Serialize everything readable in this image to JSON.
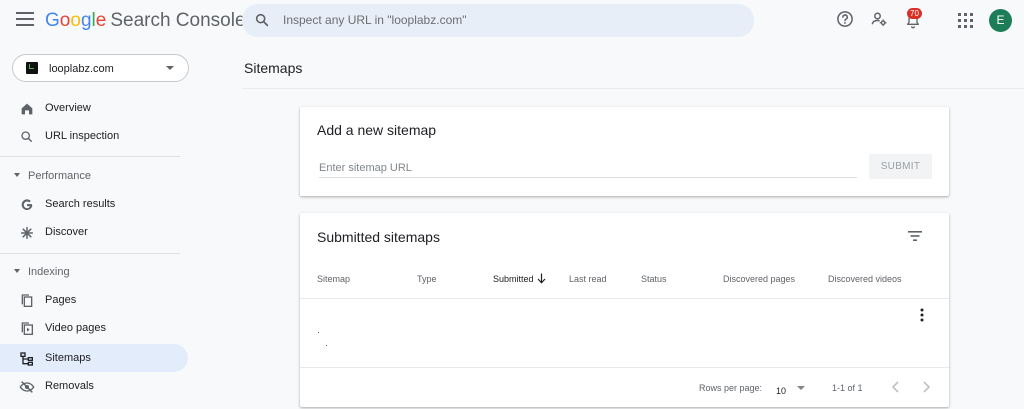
{
  "header": {
    "logo_letters": [
      "G",
      "o",
      "o",
      "g",
      "l",
      "e"
    ],
    "product": "Search Console",
    "search_placeholder": "Inspect any URL in \"looplabz.com\"",
    "notification_count": "70",
    "avatar_letter": "E"
  },
  "sidebar": {
    "property": "looplabz.com",
    "items": [
      {
        "label": "Overview",
        "icon": "home-icon"
      },
      {
        "label": "URL inspection",
        "icon": "search-icon"
      },
      {
        "section": "Performance"
      },
      {
        "label": "Search results",
        "icon": "google-g-icon"
      },
      {
        "label": "Discover",
        "icon": "asterisk-icon"
      },
      {
        "section": "Indexing"
      },
      {
        "label": "Pages",
        "icon": "pages-icon"
      },
      {
        "label": "Video pages",
        "icon": "video-pages-icon"
      },
      {
        "label": "Sitemaps",
        "icon": "sitemap-icon",
        "active": true
      },
      {
        "label": "Removals",
        "icon": "removals-icon"
      }
    ]
  },
  "main": {
    "page_title": "Sitemaps",
    "add_card": {
      "title": "Add a new sitemap",
      "input_placeholder": "Enter sitemap URL",
      "submit_label": "SUBMIT"
    },
    "submitted_card": {
      "title": "Submitted sitemaps",
      "columns": [
        "Sitemap",
        "Type",
        "Submitted",
        "Last read",
        "Status",
        "Discovered pages",
        "Discovered videos"
      ],
      "sorted_column": "Submitted",
      "rows_per_page_label": "Rows per page:",
      "rows_per_page_value": "10",
      "range_label": "1-1 of 1"
    }
  },
  "colors": {
    "accent": "#1a73e8",
    "active_nav_bg": "#e3ecfb",
    "avatar_bg": "#1e7d59",
    "badge_bg": "#d93025"
  }
}
